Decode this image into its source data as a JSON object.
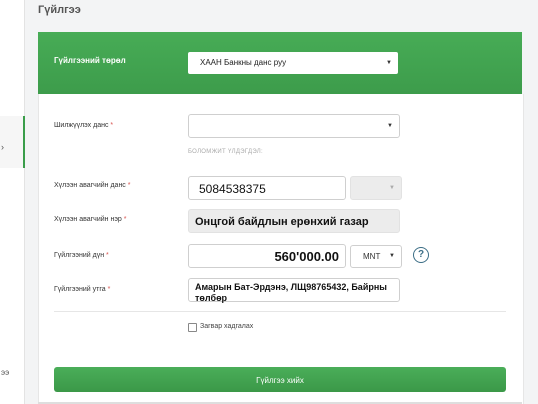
{
  "page": {
    "title": "Гүйлгээ"
  },
  "sidebar": {
    "stub_text": "ээ"
  },
  "header": {
    "type_label": "Гүйлгээний төрөл",
    "type_value": "ХААН Банкны данс руу"
  },
  "form": {
    "from_account": {
      "label": "Шилжүүлэх данс",
      "value": "",
      "helper": "БОЛОМЖИТ ҮЛДЭГДЭЛ:"
    },
    "to_account": {
      "label": "Хүлээн авагчийн данс",
      "value": "5084538375",
      "bank_value": ""
    },
    "to_name": {
      "label": "Хүлээн авагчийн нэр",
      "value": "Онцгой байдлын ерөнхий газар"
    },
    "amount": {
      "label": "Гүйлгээний дүн",
      "value": "560'000.00",
      "currency": "MNT",
      "help_glyph": "?"
    },
    "description": {
      "label": "Гүйлгээний утга",
      "value": "Амарын Бат-Эрдэнэ, ЛЩ98765432, Байрны төлбөр"
    },
    "save_template": {
      "label": "Загвар хадгалах",
      "checked": false
    },
    "required_marker": "*"
  },
  "actions": {
    "submit_label": "Гүйлгээ хийх"
  },
  "colors": {
    "accent": "#43a552",
    "required": "#d9534f"
  },
  "icons": {
    "dropdown": "chevron-down-icon",
    "help": "question-circle-icon"
  }
}
